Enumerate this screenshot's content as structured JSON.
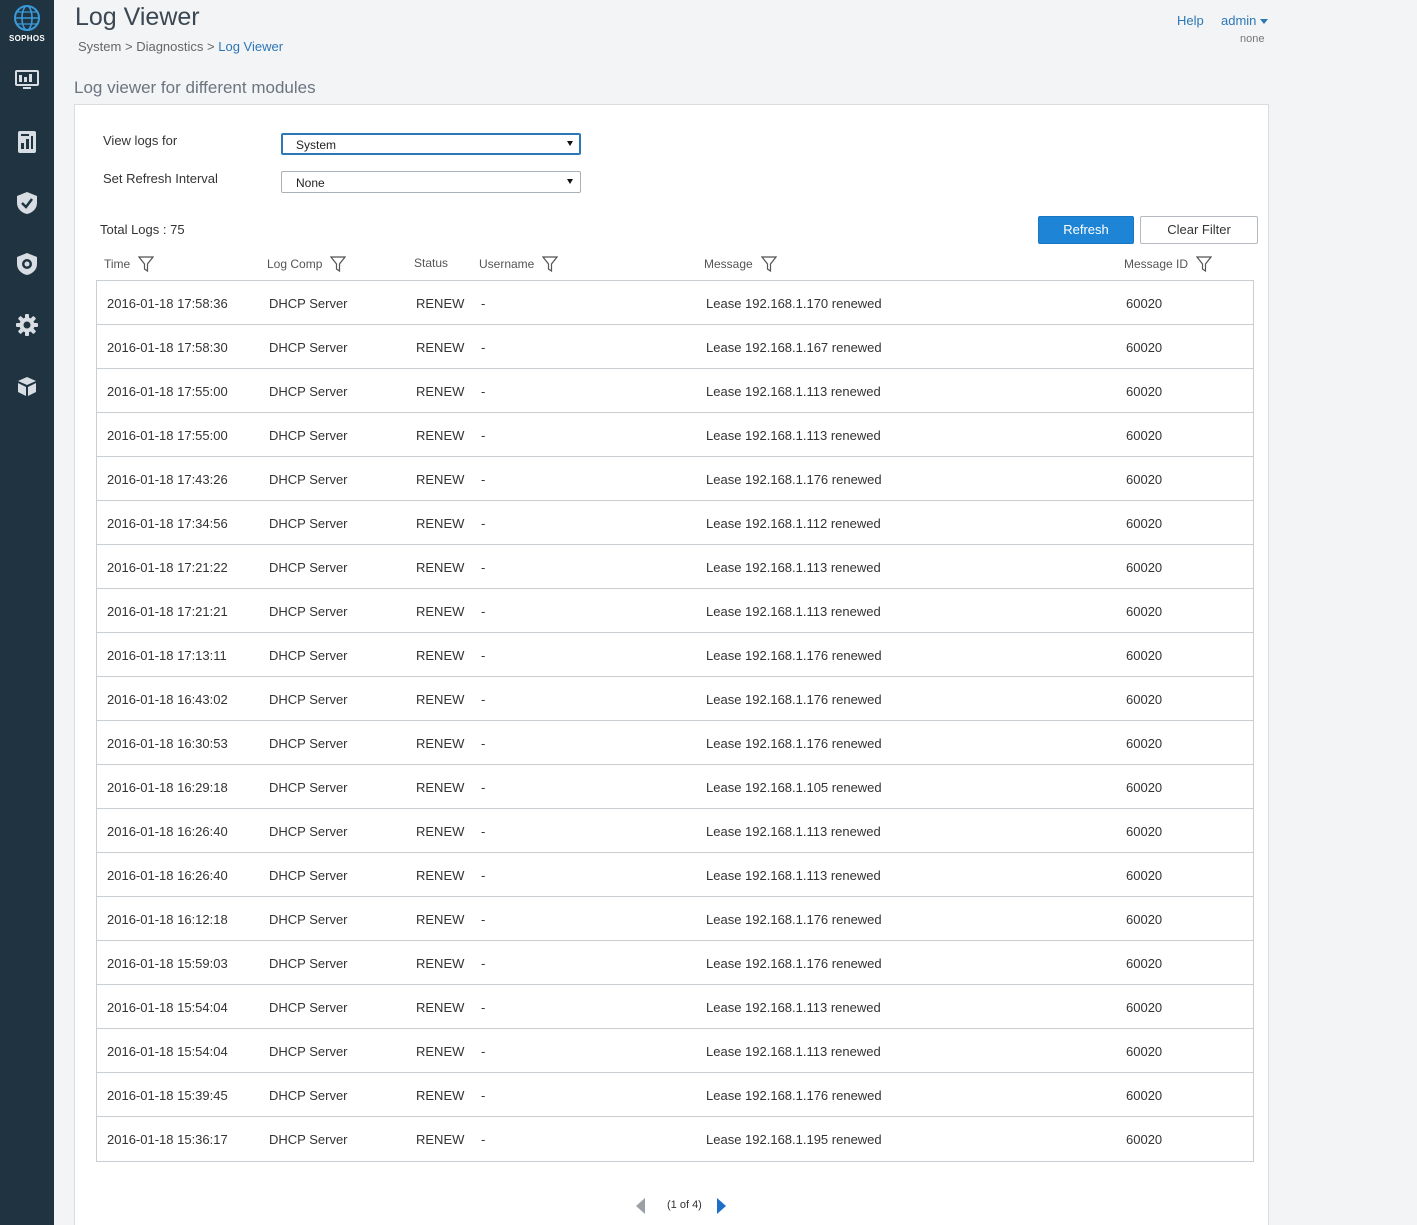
{
  "brand": {
    "name": "SOPHOS"
  },
  "sidebar": {
    "items": [
      {
        "icon": "monitor-icon",
        "name": "Monitor"
      },
      {
        "icon": "report-icon",
        "name": "Reports"
      },
      {
        "icon": "shield-check-icon",
        "name": "Protect"
      },
      {
        "icon": "shield-gear-icon",
        "name": "Configure"
      },
      {
        "icon": "gear-icon",
        "name": "System"
      },
      {
        "icon": "package-icon",
        "name": "Objects"
      }
    ]
  },
  "header": {
    "title": "Log Viewer",
    "breadcrumb": [
      "System",
      "Diagnostics",
      "Log Viewer"
    ],
    "help_label": "Help",
    "user_label": "admin",
    "user_sub": "none"
  },
  "section_title": "Log viewer for different modules",
  "filters": {
    "view_logs_label": "View logs for",
    "view_logs_value": "System",
    "refresh_interval_label": "Set Refresh Interval",
    "refresh_interval_value": "None"
  },
  "total_logs_label": "Total Logs : 75",
  "buttons": {
    "refresh": "Refresh",
    "clear_filter": "Clear Filter"
  },
  "columns": [
    "Time",
    "Log Comp",
    "Status",
    "Username",
    "Message",
    "Message ID"
  ],
  "rows": [
    [
      "2016-01-18 17:58:36",
      "DHCP Server",
      "RENEW",
      "-",
      "Lease 192.168.1.170 renewed",
      "60020"
    ],
    [
      "2016-01-18 17:58:30",
      "DHCP Server",
      "RENEW",
      "-",
      "Lease 192.168.1.167 renewed",
      "60020"
    ],
    [
      "2016-01-18 17:55:00",
      "DHCP Server",
      "RENEW",
      "-",
      "Lease 192.168.1.113 renewed",
      "60020"
    ],
    [
      "2016-01-18 17:55:00",
      "DHCP Server",
      "RENEW",
      "-",
      "Lease 192.168.1.113 renewed",
      "60020"
    ],
    [
      "2016-01-18 17:43:26",
      "DHCP Server",
      "RENEW",
      "-",
      "Lease 192.168.1.176 renewed",
      "60020"
    ],
    [
      "2016-01-18 17:34:56",
      "DHCP Server",
      "RENEW",
      "-",
      "Lease 192.168.1.112 renewed",
      "60020"
    ],
    [
      "2016-01-18 17:21:22",
      "DHCP Server",
      "RENEW",
      "-",
      "Lease 192.168.1.113 renewed",
      "60020"
    ],
    [
      "2016-01-18 17:21:21",
      "DHCP Server",
      "RENEW",
      "-",
      "Lease 192.168.1.113 renewed",
      "60020"
    ],
    [
      "2016-01-18 17:13:11",
      "DHCP Server",
      "RENEW",
      "-",
      "Lease 192.168.1.176 renewed",
      "60020"
    ],
    [
      "2016-01-18 16:43:02",
      "DHCP Server",
      "RENEW",
      "-",
      "Lease 192.168.1.176 renewed",
      "60020"
    ],
    [
      "2016-01-18 16:30:53",
      "DHCP Server",
      "RENEW",
      "-",
      "Lease 192.168.1.176 renewed",
      "60020"
    ],
    [
      "2016-01-18 16:29:18",
      "DHCP Server",
      "RENEW",
      "-",
      "Lease 192.168.1.105 renewed",
      "60020"
    ],
    [
      "2016-01-18 16:26:40",
      "DHCP Server",
      "RENEW",
      "-",
      "Lease 192.168.1.113 renewed",
      "60020"
    ],
    [
      "2016-01-18 16:26:40",
      "DHCP Server",
      "RENEW",
      "-",
      "Lease 192.168.1.113 renewed",
      "60020"
    ],
    [
      "2016-01-18 16:12:18",
      "DHCP Server",
      "RENEW",
      "-",
      "Lease 192.168.1.176 renewed",
      "60020"
    ],
    [
      "2016-01-18 15:59:03",
      "DHCP Server",
      "RENEW",
      "-",
      "Lease 192.168.1.176 renewed",
      "60020"
    ],
    [
      "2016-01-18 15:54:04",
      "DHCP Server",
      "RENEW",
      "-",
      "Lease 192.168.1.113 renewed",
      "60020"
    ],
    [
      "2016-01-18 15:54:04",
      "DHCP Server",
      "RENEW",
      "-",
      "Lease 192.168.1.113 renewed",
      "60020"
    ],
    [
      "2016-01-18 15:39:45",
      "DHCP Server",
      "RENEW",
      "-",
      "Lease 192.168.1.176 renewed",
      "60020"
    ],
    [
      "2016-01-18 15:36:17",
      "DHCP Server",
      "RENEW",
      "-",
      "Lease 192.168.1.195 renewed",
      "60020"
    ]
  ],
  "pagination": {
    "label": "(1 of 4)"
  },
  "colors": {
    "sidebar": "#1f3341",
    "accent": "#1d84d6",
    "link": "#2c77b8"
  }
}
